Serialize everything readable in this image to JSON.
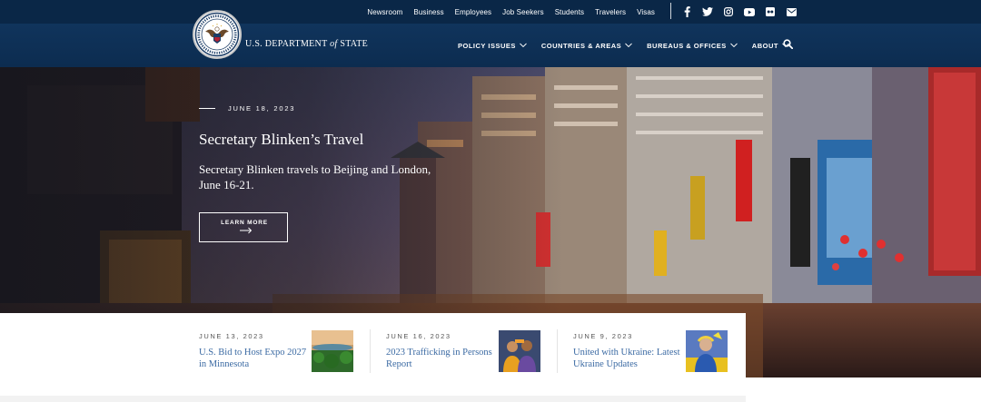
{
  "utility_nav": [
    "Newsroom",
    "Business",
    "Employees",
    "Job Seekers",
    "Students",
    "Travelers",
    "Visas"
  ],
  "social_icons": [
    "facebook-icon",
    "twitter-icon",
    "instagram-icon",
    "youtube-icon",
    "flickr-icon",
    "email-icon"
  ],
  "brand": {
    "prefix": "U.S. DEPARTMENT",
    "of": "of",
    "suffix": "STATE",
    "seal_icon": "department-of-state-seal"
  },
  "main_nav": [
    "POLICY ISSUES",
    "COUNTRIES & AREAS",
    "BUREAUS & OFFICES",
    "ABOUT"
  ],
  "search_icon": "search-icon",
  "hero": {
    "date": "JUNE 18, 2023",
    "title": "Secretary Blinken’s Travel",
    "subtitle": "Secretary Blinken travels to Beijing and London, June 16-21.",
    "button_label": "LEARN MORE"
  },
  "cards": [
    {
      "date": "JUNE 13, 2023",
      "title": "U.S. Bid to Host Expo 2027 in Minnesota"
    },
    {
      "date": "JUNE 16, 2023",
      "title": "2023 Trafficking in Persons Report"
    },
    {
      "date": "JUNE 9, 2023",
      "title": "United with Ukraine: Latest Ukraine Updates"
    }
  ],
  "colors": {
    "header_top": "#0a2747",
    "header_main": "#10345c",
    "link_blue": "#3b6aa3"
  }
}
